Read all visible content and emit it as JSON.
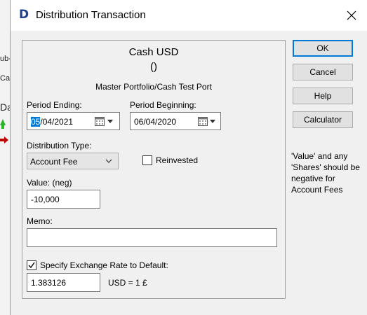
{
  "background": {
    "fragments": [
      "ub-I",
      "Ca",
      "Da"
    ]
  },
  "dialog": {
    "title": "Distribution Transaction",
    "app_icon_letter": "D"
  },
  "header": {
    "asset": "Cash USD",
    "paren": "()",
    "portfolio": "Master Portfolio/Cash Test Port"
  },
  "form": {
    "period_ending_label": "Period Ending:",
    "period_ending_sel": "05",
    "period_ending_rest": "/04/2021",
    "period_beginning_label": "Period Beginning:",
    "period_beginning_value": "06/04/2020",
    "distribution_type_label": "Distribution Type:",
    "distribution_type_value": "Account Fee",
    "reinvested_label": "Reinvested",
    "reinvested_checked": false,
    "value_label": "Value: (neg)",
    "value_value": "-10,000",
    "memo_label": "Memo:",
    "memo_value": "",
    "exchange_label": "Specify Exchange Rate to Default:",
    "exchange_checked": true,
    "exchange_value": "1.383126",
    "exchange_unit": "USD = 1 £"
  },
  "buttons": {
    "ok": "OK",
    "cancel": "Cancel",
    "help": "Help",
    "calculator": "Calculator"
  },
  "note": "'Value' and any 'Shares' should be negative for Account Fees"
}
